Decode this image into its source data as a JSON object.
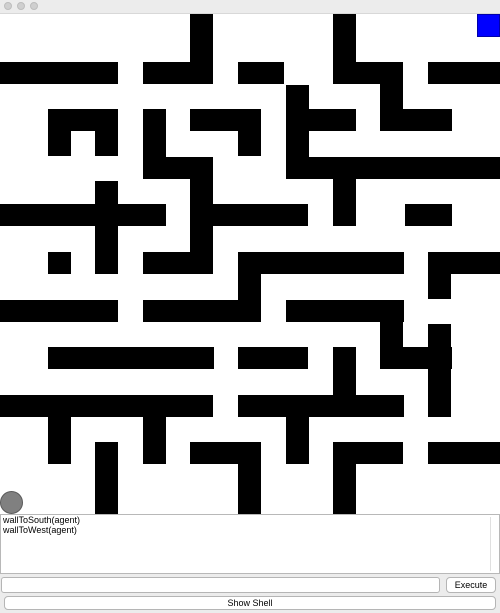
{
  "maze": {
    "grid_cells": 10,
    "open_cell": "#ffffff",
    "wall_color": "#000000",
    "goal_color": "#0000ff",
    "agent_color": "#808080"
  },
  "console": {
    "lines": [
      "wallToSouth(agent)",
      "wallToWest(agent)"
    ]
  },
  "command": {
    "value": "",
    "execute_label": "Execute"
  },
  "shell": {
    "toggle_label": "Show Shell"
  }
}
